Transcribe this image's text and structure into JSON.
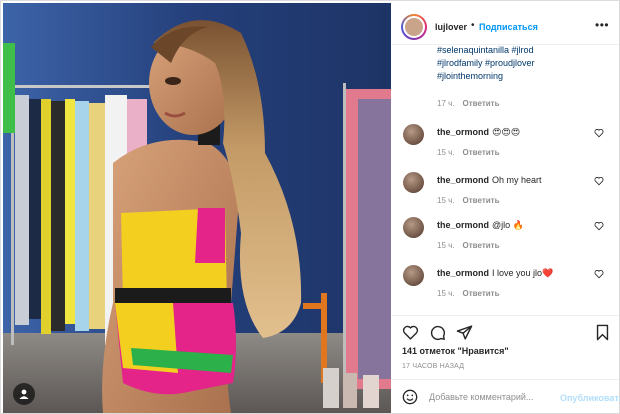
{
  "post": {
    "author": "lujlover",
    "follow_label": "Подписаться",
    "separator": "•",
    "more_label": "•••"
  },
  "caption": {
    "tags": [
      "#selenaquintanilla #jlrod",
      "#jlrodfamily #proudjlover",
      "#jlointhemorning"
    ],
    "time": "17 ч.",
    "reply_label": "Ответить"
  },
  "comments": [
    {
      "user": "the_ormond",
      "text": "😍😍😍",
      "time": "15 ч.",
      "reply_label": "Ответить"
    },
    {
      "user": "the_ormond",
      "text": "Oh my heart",
      "time": "15 ч.",
      "reply_label": "Ответить"
    },
    {
      "user": "the_ormond",
      "text": "@jlo 🔥",
      "time": "15 ч.",
      "reply_label": "Ответить"
    },
    {
      "user": "the_ormond",
      "text": "I love you jlo❤️",
      "time": "15 ч.",
      "reply_label": "Ответить"
    }
  ],
  "stats": {
    "likes": "141 отметок \"Нравится\"",
    "time_ago": "17 ЧАСОВ НАЗАД"
  },
  "composer": {
    "placeholder": "Добавьте комментарий...",
    "publish_label": "Опубликовать"
  },
  "icons": {
    "like": "heart-icon",
    "comment": "comment-icon",
    "share": "paper-plane-icon",
    "save": "bookmark-icon",
    "emoji": "smiley-icon",
    "tagged_users": "user-icon"
  },
  "colors": {
    "link": "#0095f6",
    "hashtag": "#00376b",
    "muted": "#8e8e8e",
    "publish_disabled": "#b2dffc",
    "heart_red": "#e0245e"
  }
}
